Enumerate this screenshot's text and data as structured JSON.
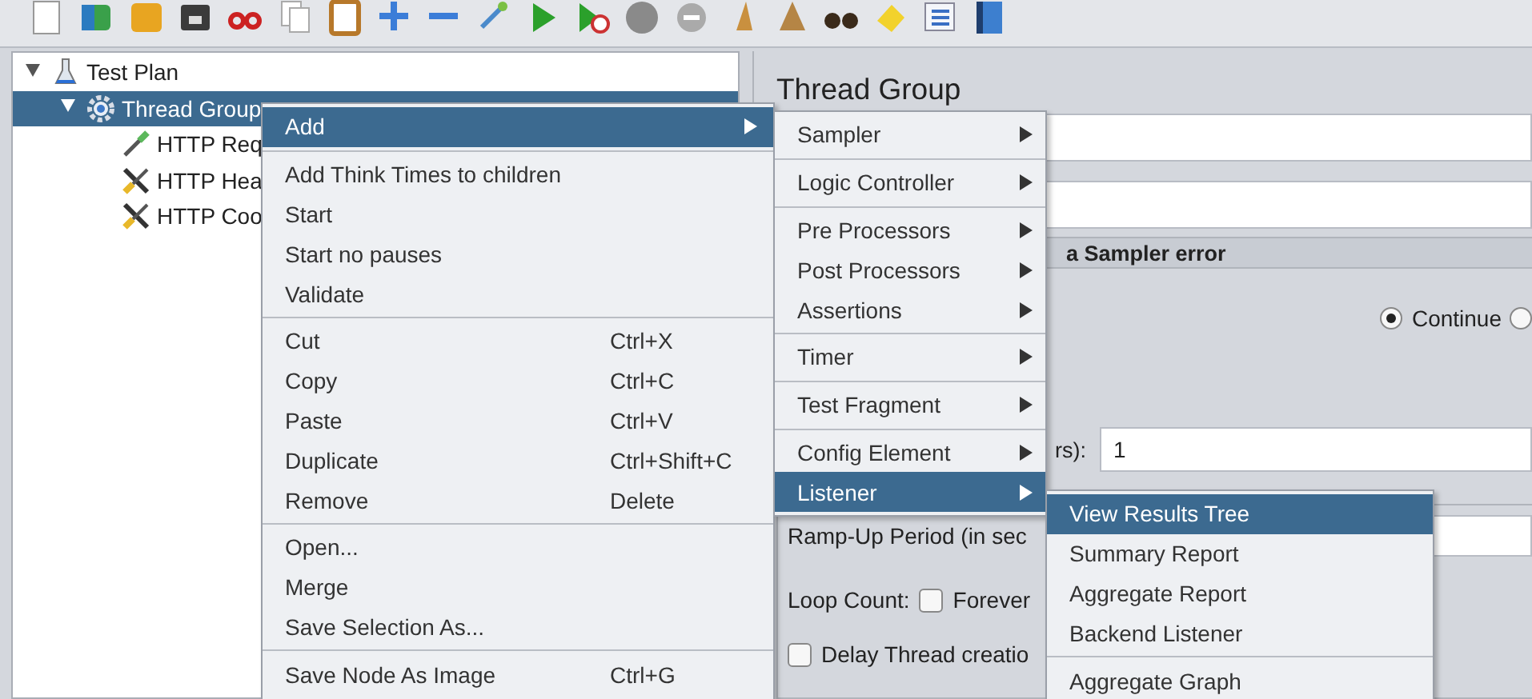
{
  "tree": [
    {
      "label": "Test Plan",
      "kind": "plan",
      "expanded": true,
      "selected": false,
      "children": [
        {
          "label": "Thread Group",
          "kind": "thread-group",
          "expanded": true,
          "selected": true,
          "children": [
            {
              "label": "HTTP Req",
              "kind": "sampler",
              "selected": false
            },
            {
              "label": "HTTP Hea",
              "kind": "config",
              "selected": false
            },
            {
              "label": "HTTP Coo",
              "kind": "config",
              "selected": false
            }
          ]
        }
      ]
    }
  ],
  "editor": {
    "title": "Thread Group",
    "error_section": "a Sampler error",
    "radios": [
      {
        "label": "Continue",
        "selected": true
      },
      {
        "selected": false
      }
    ],
    "threads_label": "rs):",
    "threads_value": "1",
    "rampup_label": "Ramp-Up Period (in sec",
    "loop_label": "Loop Count:",
    "forever": {
      "label": "Forever",
      "checked": false
    },
    "delay": {
      "label": "Delay Thread creatio",
      "checked": false
    }
  },
  "context_menu": [
    {
      "kind": "item",
      "label": "Add",
      "submenu": true,
      "selected": true
    },
    {
      "kind": "separator"
    },
    {
      "kind": "item",
      "label": "Add Think Times to children",
      "submenu": false,
      "selected": false
    },
    {
      "kind": "item",
      "label": "Start",
      "submenu": false,
      "selected": false
    },
    {
      "kind": "item",
      "label": "Start no pauses",
      "submenu": false,
      "selected": false
    },
    {
      "kind": "item",
      "label": "Validate",
      "submenu": false,
      "selected": false
    },
    {
      "kind": "separator"
    },
    {
      "kind": "item",
      "label": "Cut",
      "shortcut": "Ctrl+X",
      "submenu": false,
      "selected": false
    },
    {
      "kind": "item",
      "label": "Copy",
      "shortcut": "Ctrl+C",
      "submenu": false,
      "selected": false
    },
    {
      "kind": "item",
      "label": "Paste",
      "shortcut": "Ctrl+V",
      "submenu": false,
      "selected": false
    },
    {
      "kind": "item",
      "label": "Duplicate",
      "shortcut": "Ctrl+Shift+C",
      "submenu": false,
      "selected": false
    },
    {
      "kind": "item",
      "label": "Remove",
      "shortcut": "Delete",
      "submenu": false,
      "selected": false
    },
    {
      "kind": "separator"
    },
    {
      "kind": "item",
      "label": "Open...",
      "submenu": false,
      "selected": false
    },
    {
      "kind": "item",
      "label": "Merge",
      "submenu": false,
      "selected": false
    },
    {
      "kind": "item",
      "label": "Save Selection As...",
      "submenu": false,
      "selected": false
    },
    {
      "kind": "separator"
    },
    {
      "kind": "item",
      "label": "Save Node As Image",
      "shortcut": "Ctrl+G",
      "submenu": false,
      "selected": false
    }
  ],
  "add_menu": [
    {
      "kind": "item",
      "label": "Sampler",
      "submenu": true,
      "selected": false
    },
    {
      "kind": "separator"
    },
    {
      "kind": "item",
      "label": "Logic Controller",
      "submenu": true,
      "selected": false
    },
    {
      "kind": "separator"
    },
    {
      "kind": "item",
      "label": "Pre Processors",
      "submenu": true,
      "selected": false
    },
    {
      "kind": "item",
      "label": "Post Processors",
      "submenu": true,
      "selected": false
    },
    {
      "kind": "item",
      "label": "Assertions",
      "submenu": true,
      "selected": false
    },
    {
      "kind": "separator"
    },
    {
      "kind": "item",
      "label": "Timer",
      "submenu": true,
      "selected": false
    },
    {
      "kind": "separator"
    },
    {
      "kind": "item",
      "label": "Test Fragment",
      "submenu": true,
      "selected": false
    },
    {
      "kind": "separator"
    },
    {
      "kind": "item",
      "label": "Config Element",
      "submenu": true,
      "selected": false
    },
    {
      "kind": "item",
      "label": "Listener",
      "submenu": true,
      "selected": true
    }
  ],
  "listener_menu": [
    {
      "kind": "item",
      "label": "View Results Tree",
      "submenu": false,
      "selected": true
    },
    {
      "kind": "item",
      "label": "Summary Report",
      "submenu": false,
      "selected": false
    },
    {
      "kind": "item",
      "label": "Aggregate Report",
      "submenu": false,
      "selected": false
    },
    {
      "kind": "item",
      "label": "Backend Listener",
      "submenu": false,
      "selected": false
    },
    {
      "kind": "separator"
    },
    {
      "kind": "item",
      "label": "Aggregate Graph",
      "submenu": false,
      "selected": false
    }
  ]
}
